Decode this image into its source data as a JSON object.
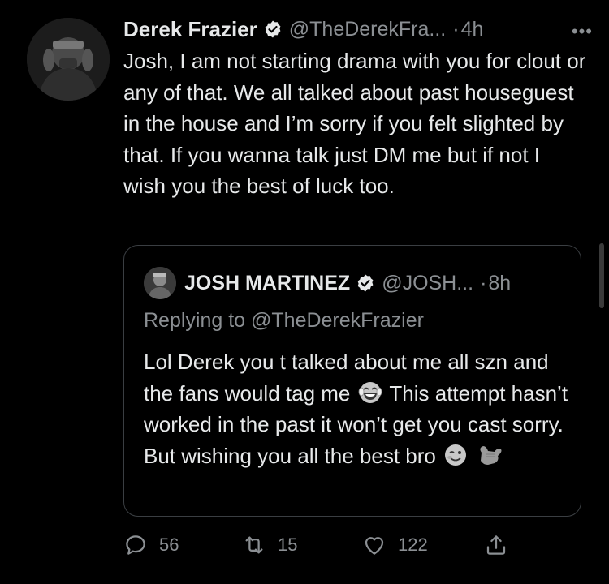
{
  "tweet": {
    "author_name": "Derek Frazier",
    "author_handle": "@TheDerekFra...",
    "separator": "·",
    "time": "4h",
    "more": "•••",
    "body": "Josh, I am not starting drama with you for clout or any of that. We all talked about past houseguest in the house and I’m sorry if you felt slighted by that. If you wanna talk just DM me but if not I wish you the best of luck too."
  },
  "quote": {
    "author_name": "JOSH MARTINEZ",
    "author_handle": "@JOSH...",
    "separator": "·",
    "time": "8h",
    "replying_to": "Replying to @TheDerekFrazier",
    "text_1": "Lol Derek you t talked about me all szn and the fans would tag me",
    "text_2": "This attempt hasn’t worked in the past it won’t get you cast sorry. But wishing you all the best bro",
    "emojis": [
      "laughing-tears-emoji",
      "winking-emoji",
      "call-me-hand-emoji"
    ]
  },
  "actions": {
    "reply_count": "56",
    "retweet_count": "15",
    "like_count": "122"
  },
  "icons": [
    "verified-icon",
    "more-icon",
    "reply-icon",
    "retweet-icon",
    "like-icon",
    "share-icon"
  ],
  "colors": {
    "background": "#000000",
    "text": "#e7e9ea",
    "secondary": "#8b8f93",
    "border": "#3a3e42"
  }
}
